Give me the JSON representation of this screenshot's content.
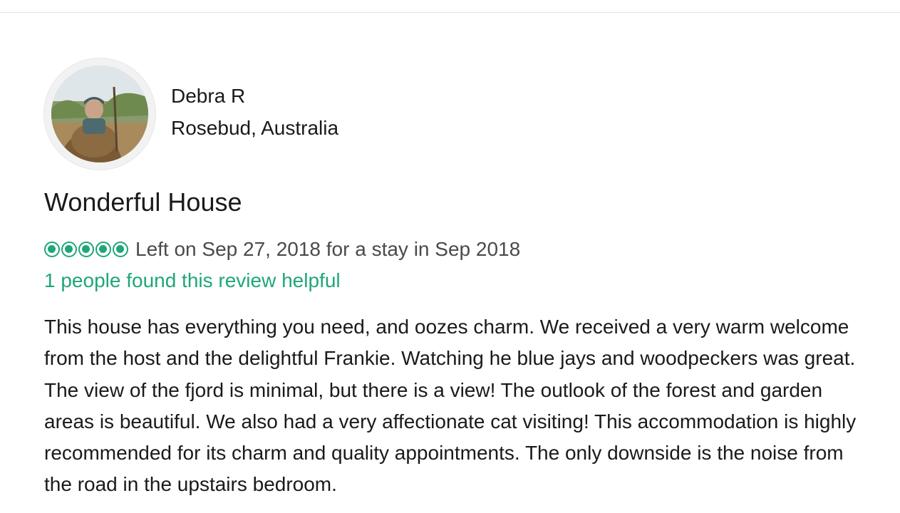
{
  "reviewer": {
    "name": "Debra R",
    "location": "Rosebud, Australia",
    "avatar_icon": "user-photo-avatar"
  },
  "review": {
    "title": "Wonderful House",
    "rating_bubbles": 5,
    "rating_max": 5,
    "rating_color": "#1fa67a",
    "stay_text": "Left on Sep 27, 2018 for a stay in Sep 2018",
    "helpful_text": "1 people found this review helpful",
    "body": "This house has everything you need, and oozes charm. We received a very warm welcome from the host and the delightful Frankie. Watching he blue jays and woodpeckers was great. The view of the fjord is minimal, but there is a view! The outlook of the forest and garden areas is beautiful. We also had a very affectionate cat visiting! This accommodation is highly recommended for its charm and quality appointments. The only downside is the noise from the road in the upstairs bedroom."
  }
}
